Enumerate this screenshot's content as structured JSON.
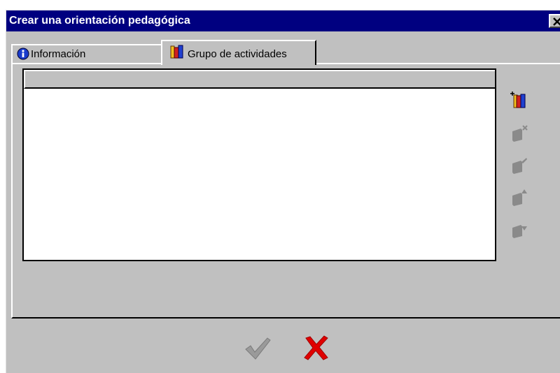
{
  "window": {
    "title": "Crear una orientación pedagógica",
    "close_icon": "close-x-icon"
  },
  "tabs": [
    {
      "label": "Información",
      "icon": "info-circle-icon",
      "selected": false
    },
    {
      "label": "Grupo de actividades",
      "icon": "books-icon",
      "selected": true
    }
  ],
  "activity_list": {
    "columns": [
      ""
    ],
    "rows": []
  },
  "side_toolbar": [
    {
      "action": "add-activity-group",
      "icon": "books-add-icon",
      "enabled": true
    },
    {
      "action": "delete-activity-group",
      "icon": "books-delete-icon",
      "enabled": false
    },
    {
      "action": "edit-activity-group",
      "icon": "books-edit-icon",
      "enabled": false
    },
    {
      "action": "move-up-activity-group",
      "icon": "books-move-up-icon",
      "enabled": false
    },
    {
      "action": "move-down-activity-group",
      "icon": "books-move-down-icon",
      "enabled": false
    }
  ],
  "footer": {
    "ok_icon": "checkmark-icon",
    "ok_enabled": false,
    "cancel_icon": "red-x-icon",
    "cancel_enabled": true
  },
  "colors": {
    "titlebar": "#000080",
    "face": "#c0c0c0",
    "cancel_red": "#e00000",
    "disabled_gray": "#8a8a8a"
  }
}
